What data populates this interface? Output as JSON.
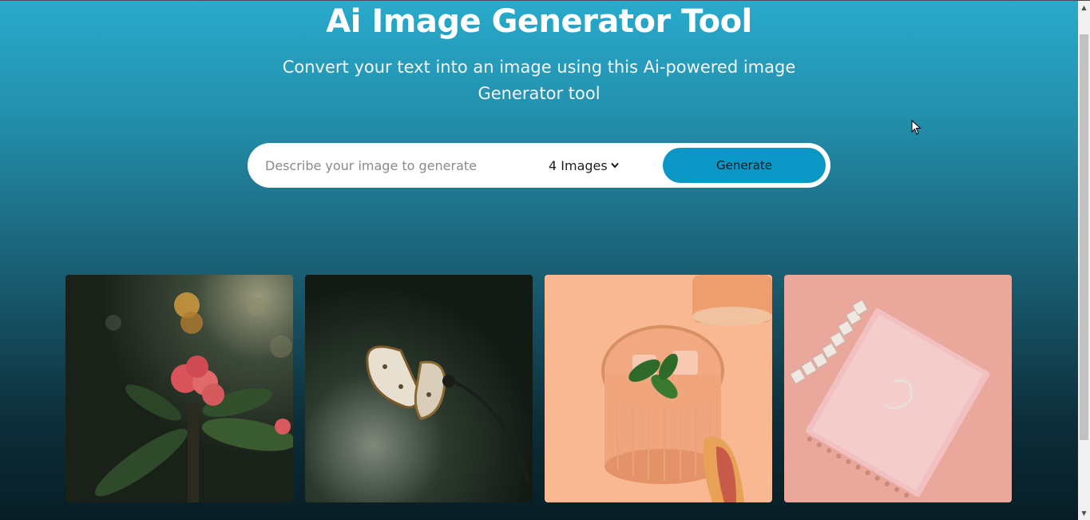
{
  "hero": {
    "title": "Ai Image Generator Tool",
    "subtitle": "Convert your text into an image using this Ai-powered image Generator tool"
  },
  "search": {
    "placeholder": "Describe your image to generate",
    "value": "",
    "count_selected": "4 Images",
    "generate_label": "Generate"
  },
  "gallery": {
    "images": [
      {
        "subject": "red flower with bokeh background"
      },
      {
        "subject": "butterfly on dark green background"
      },
      {
        "subject": "peach iced drink with mint and peach slice"
      },
      {
        "subject": "pink notebook with January letter tiles"
      }
    ]
  },
  "colors": {
    "accent": "#0b97c6",
    "bg_top": "#29aacc",
    "bg_bottom": "#071d25"
  }
}
